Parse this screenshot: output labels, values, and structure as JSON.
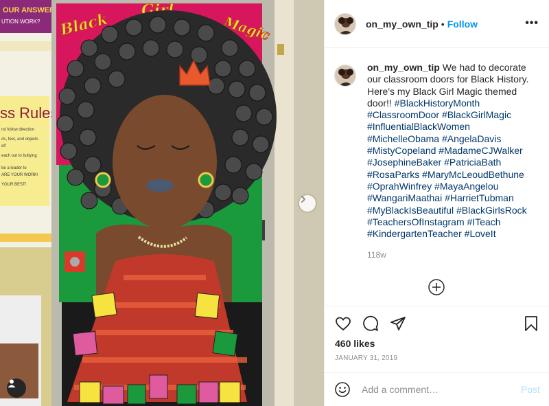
{
  "post": {
    "username": "on_my_own_tip",
    "follow_label": "Follow",
    "separator": "•",
    "more_icon": "more-options-icon",
    "caption_text": "We had to decorate our classroom doors for Black History. Here's my Black Girl Magic themed door!!",
    "hashtags": [
      "#BlackHistoryMonth",
      "#ClassroomDoor",
      "#BlackGirlMagic",
      "#InfluentialBlackWomen",
      "#MichelleObama",
      "#AngelaDavis",
      "#MistyCopeland",
      "#MadameCJWalker",
      "#JosephineBaker",
      "#PatriciaBath",
      "#RosaParks",
      "#MaryMcLeoudBethune",
      "#OprahWinfrey",
      "#MayaAngelou",
      "#WangariMaathai",
      "#HarrietTubman",
      "#MyBlackIsBeautiful",
      "#BlackGirlsRock",
      "#TeachersOfInstagram",
      "#ITeach",
      "#KindergartenTeacher",
      "#LoveIt"
    ],
    "time_ago": "118w",
    "likes": "460 likes",
    "date": "JANUARY 31, 2019",
    "comment_placeholder": "Add a comment…",
    "post_label": "Post"
  },
  "photo": {
    "door_title_words": [
      "Black",
      "Girl",
      "Magic"
    ],
    "board_text_top": "OUR ANSWER",
    "board_text_top2": "UTION WORK?",
    "board_text_rules": "ss Rules",
    "board_rule_lines": [
      "nd follow direction",
      "ds, feet, and objects",
      "elf",
      "each out to bullying",
      "be a leader to",
      "ARE YOUR WORK!",
      "YOUR BEST!"
    ]
  },
  "colors": {
    "accent_blue": "#0095f6",
    "hashtag_blue": "#00376b",
    "muted": "#8e8e8e",
    "door_red": "#d8165e",
    "door_green": "#1a9a3c",
    "door_black": "#1a1a1a",
    "skin": "#7a4a2e",
    "dress": "#c0392b"
  }
}
